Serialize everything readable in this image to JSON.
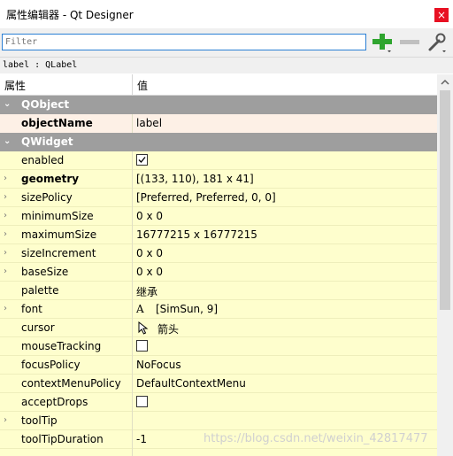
{
  "window": {
    "title": "属性编辑器 - Qt Designer",
    "close_glyph": "×"
  },
  "toolbar": {
    "filter_placeholder": "Filter",
    "icons": [
      "plus-icon",
      "minus-icon",
      "wrench-icon"
    ]
  },
  "subtitle": "label : QLabel",
  "header": {
    "col1": "属性",
    "col2": "值"
  },
  "groups": {
    "qobject": "QObject",
    "qwidget": "QWidget"
  },
  "properties": {
    "objectName": {
      "name": "objectName",
      "value": "label"
    },
    "enabled": {
      "name": "enabled",
      "checked": true
    },
    "geometry": {
      "name": "geometry",
      "value": "[(133, 110), 181 x 41]"
    },
    "sizePolicy": {
      "name": "sizePolicy",
      "value": "[Preferred, Preferred, 0, 0]"
    },
    "minimumSize": {
      "name": "minimumSize",
      "value": "0 x 0"
    },
    "maximumSize": {
      "name": "maximumSize",
      "value": "16777215 x 16777215"
    },
    "sizeIncrement": {
      "name": "sizeIncrement",
      "value": "0 x 0"
    },
    "baseSize": {
      "name": "baseSize",
      "value": "0 x 0"
    },
    "palette": {
      "name": "palette",
      "value": "继承"
    },
    "font": {
      "name": "font",
      "value": "[SimSun, 9]",
      "icon": "A"
    },
    "cursor": {
      "name": "cursor",
      "value": "箭头"
    },
    "mouseTracking": {
      "name": "mouseTracking",
      "checked": false
    },
    "focusPolicy": {
      "name": "focusPolicy",
      "value": "NoFocus"
    },
    "contextMenuPolicy": {
      "name": "contextMenuPolicy",
      "value": "DefaultContextMenu"
    },
    "acceptDrops": {
      "name": "acceptDrops",
      "checked": false
    },
    "toolTip": {
      "name": "toolTip",
      "value": ""
    },
    "toolTipDuration": {
      "name": "toolTipDuration",
      "value": "-1"
    }
  },
  "watermark": "https://blog.csdn.net/weixin_42817477",
  "colors": {
    "accent": "#2a7fd4",
    "group_bg": "#9e9e9e",
    "row_bg": "#fefecd",
    "selected_bg": "#fdf0e6",
    "close_bg": "#e81123"
  }
}
